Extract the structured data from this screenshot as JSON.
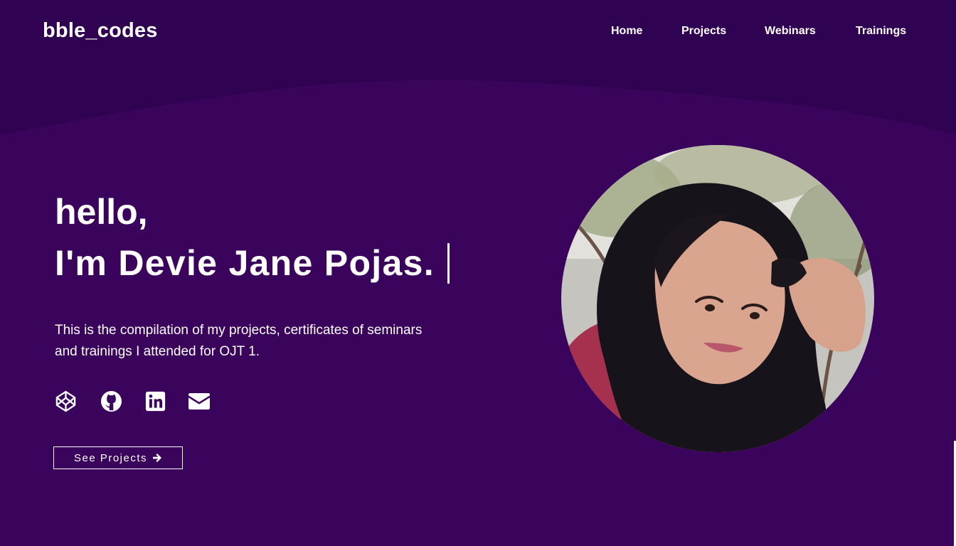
{
  "nav": {
    "brand": "bble_codes",
    "links": [
      "Home",
      "Projects",
      "Webinars",
      "Trainings"
    ]
  },
  "hero": {
    "greeting": "hello,",
    "name": "I'm Devie Jane Pojas.",
    "description": "This is the compilation of my projects, certificates of seminars and trainings I attended for OJT 1.",
    "cta_label": "See Projects"
  },
  "social": {
    "icons": [
      "codepen-icon",
      "github-icon",
      "linkedin-icon",
      "mail-icon"
    ]
  },
  "colors": {
    "background": "#3b045c",
    "header_band": "#300352",
    "text": "#ffffff"
  }
}
